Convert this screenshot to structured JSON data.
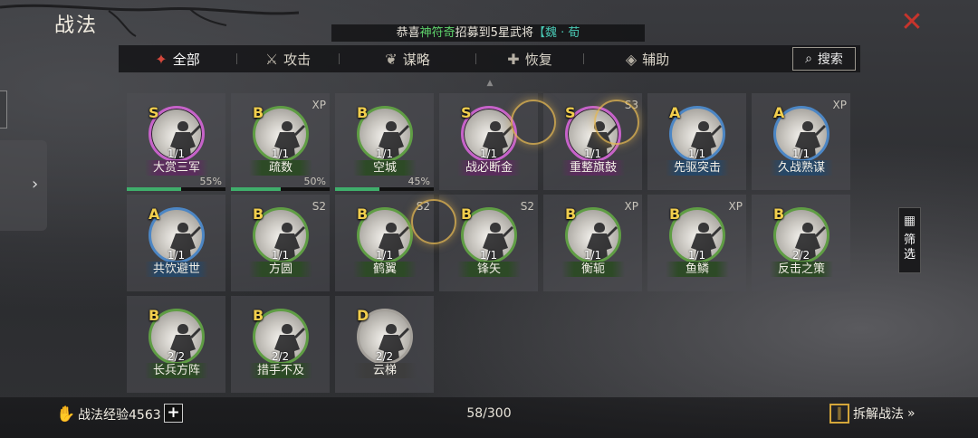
{
  "header": {
    "title": "战法",
    "close_label": "✕"
  },
  "banner": {
    "prefix": "恭喜",
    "highlight": "神符奇",
    "middle": "招募到5星武将",
    "bracket": "【魏 · 荀"
  },
  "tabs": [
    {
      "label": "全部",
      "icon": "✦",
      "icon_name": "all-icon",
      "active": true
    },
    {
      "label": "攻击",
      "icon": "⚔",
      "icon_name": "attack-icon",
      "active": false
    },
    {
      "label": "谋略",
      "icon": "❦",
      "icon_name": "strategy-icon",
      "active": false
    },
    {
      "label": "恢复",
      "icon": "✚",
      "icon_name": "recover-icon",
      "active": false
    },
    {
      "label": "辅助",
      "icon": "◈",
      "icon_name": "assist-icon",
      "active": false
    }
  ],
  "search": {
    "label": "搜索",
    "icon": "⌕"
  },
  "filter": {
    "label_1": "筛",
    "label_2": "选",
    "icon": "▦"
  },
  "side": {
    "arrow": "›"
  },
  "cards": [
    {
      "grade": "S",
      "tag": "",
      "level": "1/1",
      "name": "大赏三军",
      "progress": 55,
      "pct": "55%"
    },
    {
      "grade": "B",
      "tag": "XP",
      "level": "1/1",
      "name": "疏数",
      "progress": 50,
      "pct": "50%"
    },
    {
      "grade": "B",
      "tag": "",
      "level": "1/1",
      "name": "空城",
      "progress": 45,
      "pct": "45%"
    },
    {
      "grade": "S",
      "tag": "",
      "level": "1/1",
      "name": "战必断金"
    },
    {
      "grade": "S",
      "tag": "S3",
      "level": "1/1",
      "name": "重整旗鼓"
    },
    {
      "grade": "A",
      "tag": "",
      "level": "1/1",
      "name": "先驱突击"
    },
    {
      "grade": "A",
      "tag": "XP",
      "level": "1/1",
      "name": "久战熟谋"
    },
    {
      "grade": "A",
      "tag": "",
      "level": "1/1",
      "name": "共饮避世"
    },
    {
      "grade": "B",
      "tag": "S2",
      "level": "1/1",
      "name": "方圆"
    },
    {
      "grade": "B",
      "tag": "S2",
      "level": "1/1",
      "name": "鹤翼"
    },
    {
      "grade": "B",
      "tag": "S2",
      "level": "1/1",
      "name": "锋矢"
    },
    {
      "grade": "B",
      "tag": "XP",
      "level": "1/1",
      "name": "衡轭"
    },
    {
      "grade": "B",
      "tag": "XP",
      "level": "1/1",
      "name": "鱼鳞"
    },
    {
      "grade": "B",
      "tag": "",
      "level": "2/2",
      "name": "反击之策"
    },
    {
      "grade": "B",
      "tag": "",
      "level": "2/2",
      "name": "长兵方阵"
    },
    {
      "grade": "B",
      "tag": "",
      "level": "2/2",
      "name": "措手不及"
    },
    {
      "grade": "D",
      "tag": "",
      "level": "2/2",
      "name": "云梯"
    }
  ],
  "footer": {
    "exp_label": "战法经验4563",
    "plus": "+",
    "count": "58/300",
    "dismantle_label": "拆解战法",
    "dismantle_arrow": "»"
  }
}
